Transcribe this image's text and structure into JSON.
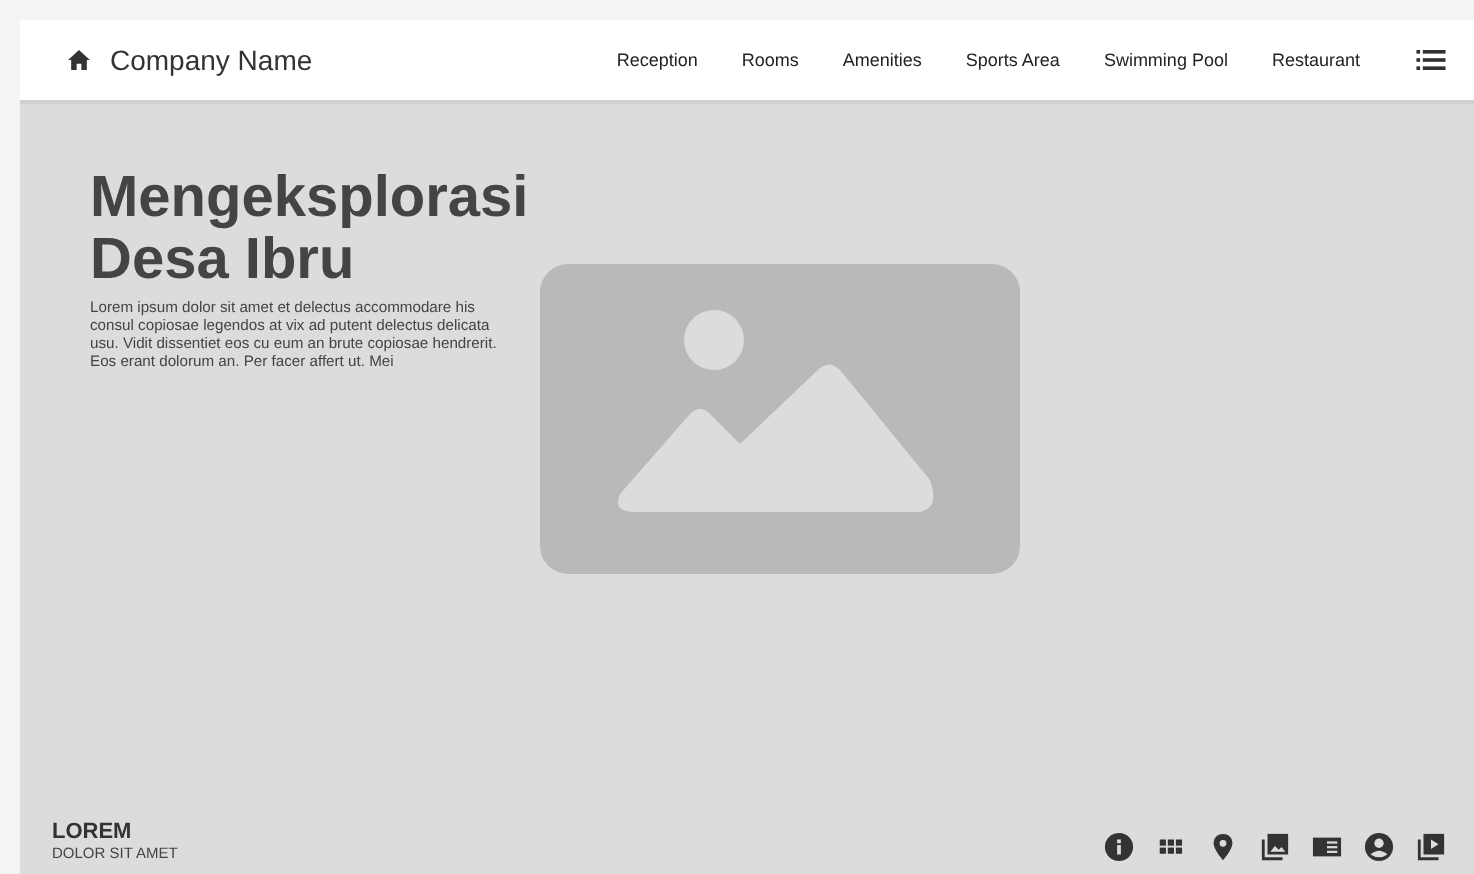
{
  "header": {
    "brand": "Company Name",
    "nav": [
      "Reception",
      "Rooms",
      "Amenities",
      "Sports Area",
      "Swimming Pool",
      "Restaurant"
    ]
  },
  "hero": {
    "title": "Mengeksplorasi Desa Ibru",
    "text": "Lorem ipsum dolor sit amet et delectus accommodare his consul copiosae legendos at vix ad putent delectus delicata usu. Vidit dissentiet eos cu eum an brute copiosae hendrerit. Eos erant dolorum an. Per facer affert ut. Mei"
  },
  "footer": {
    "title": "LOREM",
    "subtitle": "DOLOR SIT AMET",
    "icons": [
      {
        "kind": "info"
      },
      {
        "kind": "apps"
      },
      {
        "kind": "pin"
      },
      {
        "kind": "photos"
      },
      {
        "kind": "card"
      },
      {
        "kind": "account"
      },
      {
        "kind": "video"
      }
    ]
  }
}
